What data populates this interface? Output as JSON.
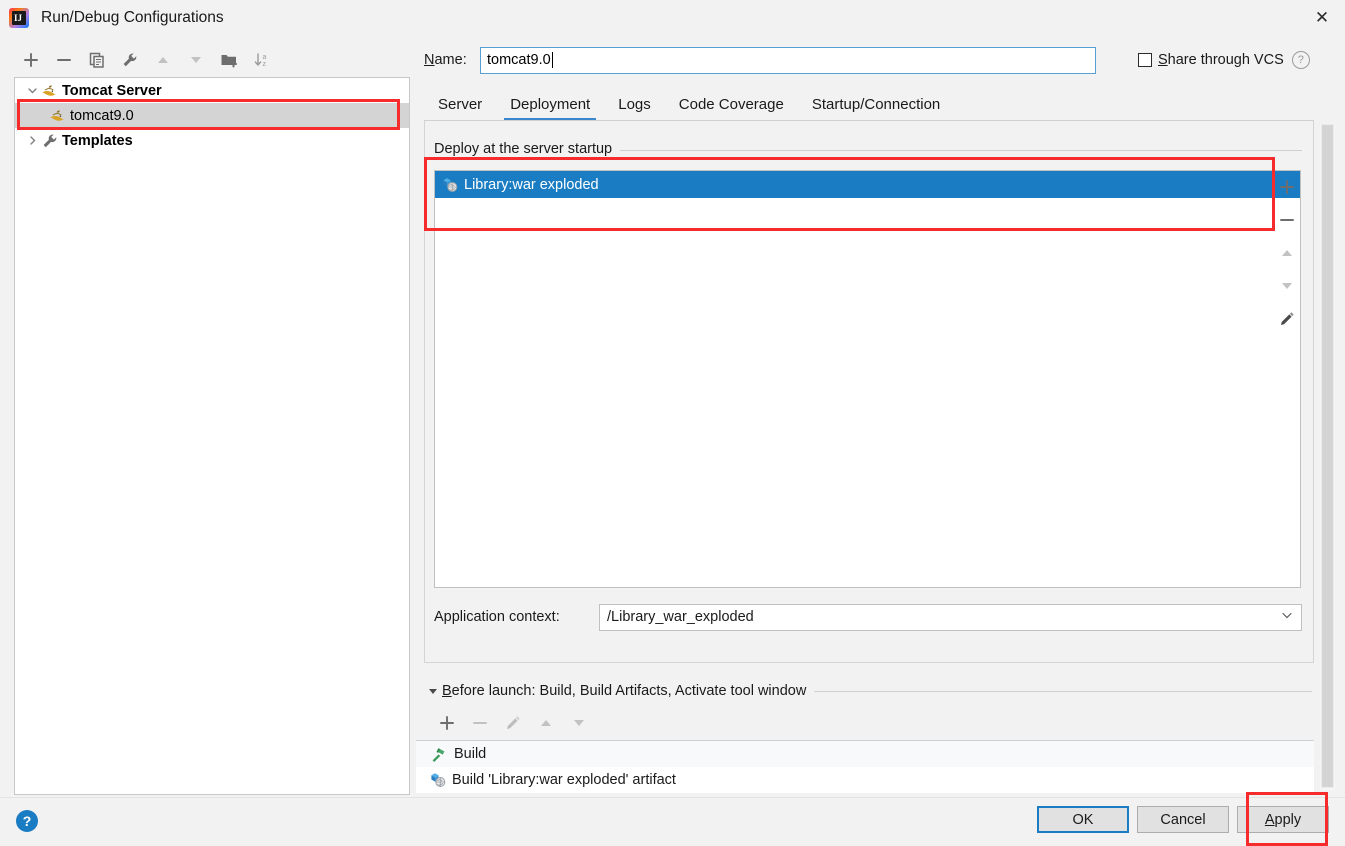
{
  "window": {
    "title": "Run/Debug Configurations",
    "app_icon": "intellij-idea-logo",
    "close_icon": "✕"
  },
  "left_toolbar": {
    "buttons": [
      {
        "name": "add-configuration-button",
        "icon": "plus-icon",
        "label": "+"
      },
      {
        "name": "remove-configuration-button",
        "icon": "minus-icon",
        "label": "−"
      },
      {
        "name": "copy-configuration-button",
        "icon": "copy-icon",
        "label": "Copy"
      },
      {
        "name": "edit-templates-button",
        "icon": "wrench-icon",
        "label": "Edit Templates"
      },
      {
        "name": "move-up-button",
        "icon": "arrow-up-icon",
        "label": "Move Up"
      },
      {
        "name": "move-down-button",
        "icon": "arrow-down-icon",
        "label": "Move Down"
      },
      {
        "name": "new-folder-button",
        "icon": "folder-add-icon",
        "label": "New Folder"
      },
      {
        "name": "sort-button",
        "icon": "sort-az-icon",
        "label": "Sort Configurations"
      }
    ]
  },
  "tree": {
    "nodes": [
      {
        "label": "Tomcat Server",
        "icon": "tomcat-cat-icon",
        "expanded": true,
        "bold": true,
        "selected": false,
        "depth": 0
      },
      {
        "label": "tomcat9.0",
        "icon": "tomcat-cat-icon",
        "expanded": null,
        "bold": false,
        "selected": true,
        "depth": 1
      },
      {
        "label": "Templates",
        "icon": "wrench-icon",
        "expanded": false,
        "bold": true,
        "selected": false,
        "depth": 0
      }
    ]
  },
  "name_field": {
    "label": "Name:",
    "label_mnemonic": "N",
    "value": "tomcat9.0",
    "placeholder": ""
  },
  "share_vcs": {
    "label": "Share through VCS",
    "label_mnemonic": "S",
    "checked": false,
    "help_icon": "question-mark-icon",
    "help_glyph": "?"
  },
  "tabs": {
    "items": [
      {
        "label": "Server",
        "active": false
      },
      {
        "label": "Deployment",
        "active": true
      },
      {
        "label": "Logs",
        "active": false
      },
      {
        "label": "Code Coverage",
        "active": false
      },
      {
        "label": "Startup/Connection",
        "active": false
      }
    ],
    "active_color": "#3a87d0"
  },
  "deployment": {
    "group_title": "Deploy at the server startup",
    "items": [
      {
        "label": "Library:war exploded",
        "icon": "artifact-icon",
        "selected": true
      }
    ],
    "selection_color": "#1a7dc4",
    "side_buttons": [
      {
        "name": "add-artifact-button",
        "icon": "plus-icon",
        "label": "+",
        "enabled": true
      },
      {
        "name": "remove-artifact-button",
        "icon": "minus-icon",
        "label": "−",
        "enabled": true
      },
      {
        "name": "move-artifact-up",
        "icon": "arrow-up-icon",
        "label": "Move Up",
        "enabled": false
      },
      {
        "name": "move-artifact-down",
        "icon": "arrow-down-icon",
        "label": "Move Down",
        "enabled": false
      },
      {
        "name": "edit-artifact-button",
        "icon": "pencil-icon",
        "label": "Edit",
        "enabled": true
      }
    ],
    "application_context": {
      "label": "Application context:",
      "value": "/Library_war_exploded",
      "dropdown_icon": "chevron-down-icon"
    }
  },
  "before_launch": {
    "title": "Before launch: Build, Build Artifacts, Activate tool window",
    "title_mnemonic": "B",
    "expanded": true,
    "collapse_icon": "triangle-down-icon",
    "toolbar": [
      {
        "name": "before-launch-add-button",
        "icon": "plus-icon",
        "label": "+",
        "enabled": true
      },
      {
        "name": "before-launch-remove-button",
        "icon": "minus-icon",
        "label": "−",
        "enabled": false
      },
      {
        "name": "before-launch-edit-button",
        "icon": "pencil-icon",
        "label": "Edit",
        "enabled": false
      },
      {
        "name": "before-launch-up-button",
        "icon": "arrow-up-icon",
        "label": "Move Up",
        "enabled": false
      },
      {
        "name": "before-launch-down-button",
        "icon": "arrow-down-icon",
        "label": "Move Down",
        "enabled": false
      }
    ],
    "items": [
      {
        "label": "Build",
        "icon": "hammer-icon"
      },
      {
        "label": "Build 'Library:war exploded' artifact",
        "icon": "artifact-icon"
      }
    ]
  },
  "footer": {
    "help_icon": "question-mark-circle-icon",
    "help_glyph": "?",
    "buttons": [
      {
        "name": "ok-button",
        "label": "OK",
        "default": true,
        "mnemonic": ""
      },
      {
        "name": "cancel-button",
        "label": "Cancel",
        "default": false,
        "mnemonic": ""
      },
      {
        "name": "apply-button",
        "label": "Apply",
        "default": false,
        "mnemonic": "A"
      }
    ]
  },
  "annotations": {
    "color": "#f62c2c",
    "boxes": [
      {
        "name": "highlight-tomcat-config",
        "target": "tomcat9.0 tree row"
      },
      {
        "name": "highlight-deployment-artifact",
        "target": "Deploy at the server startup list"
      },
      {
        "name": "highlight-apply-button",
        "target": "Apply button"
      }
    ]
  }
}
